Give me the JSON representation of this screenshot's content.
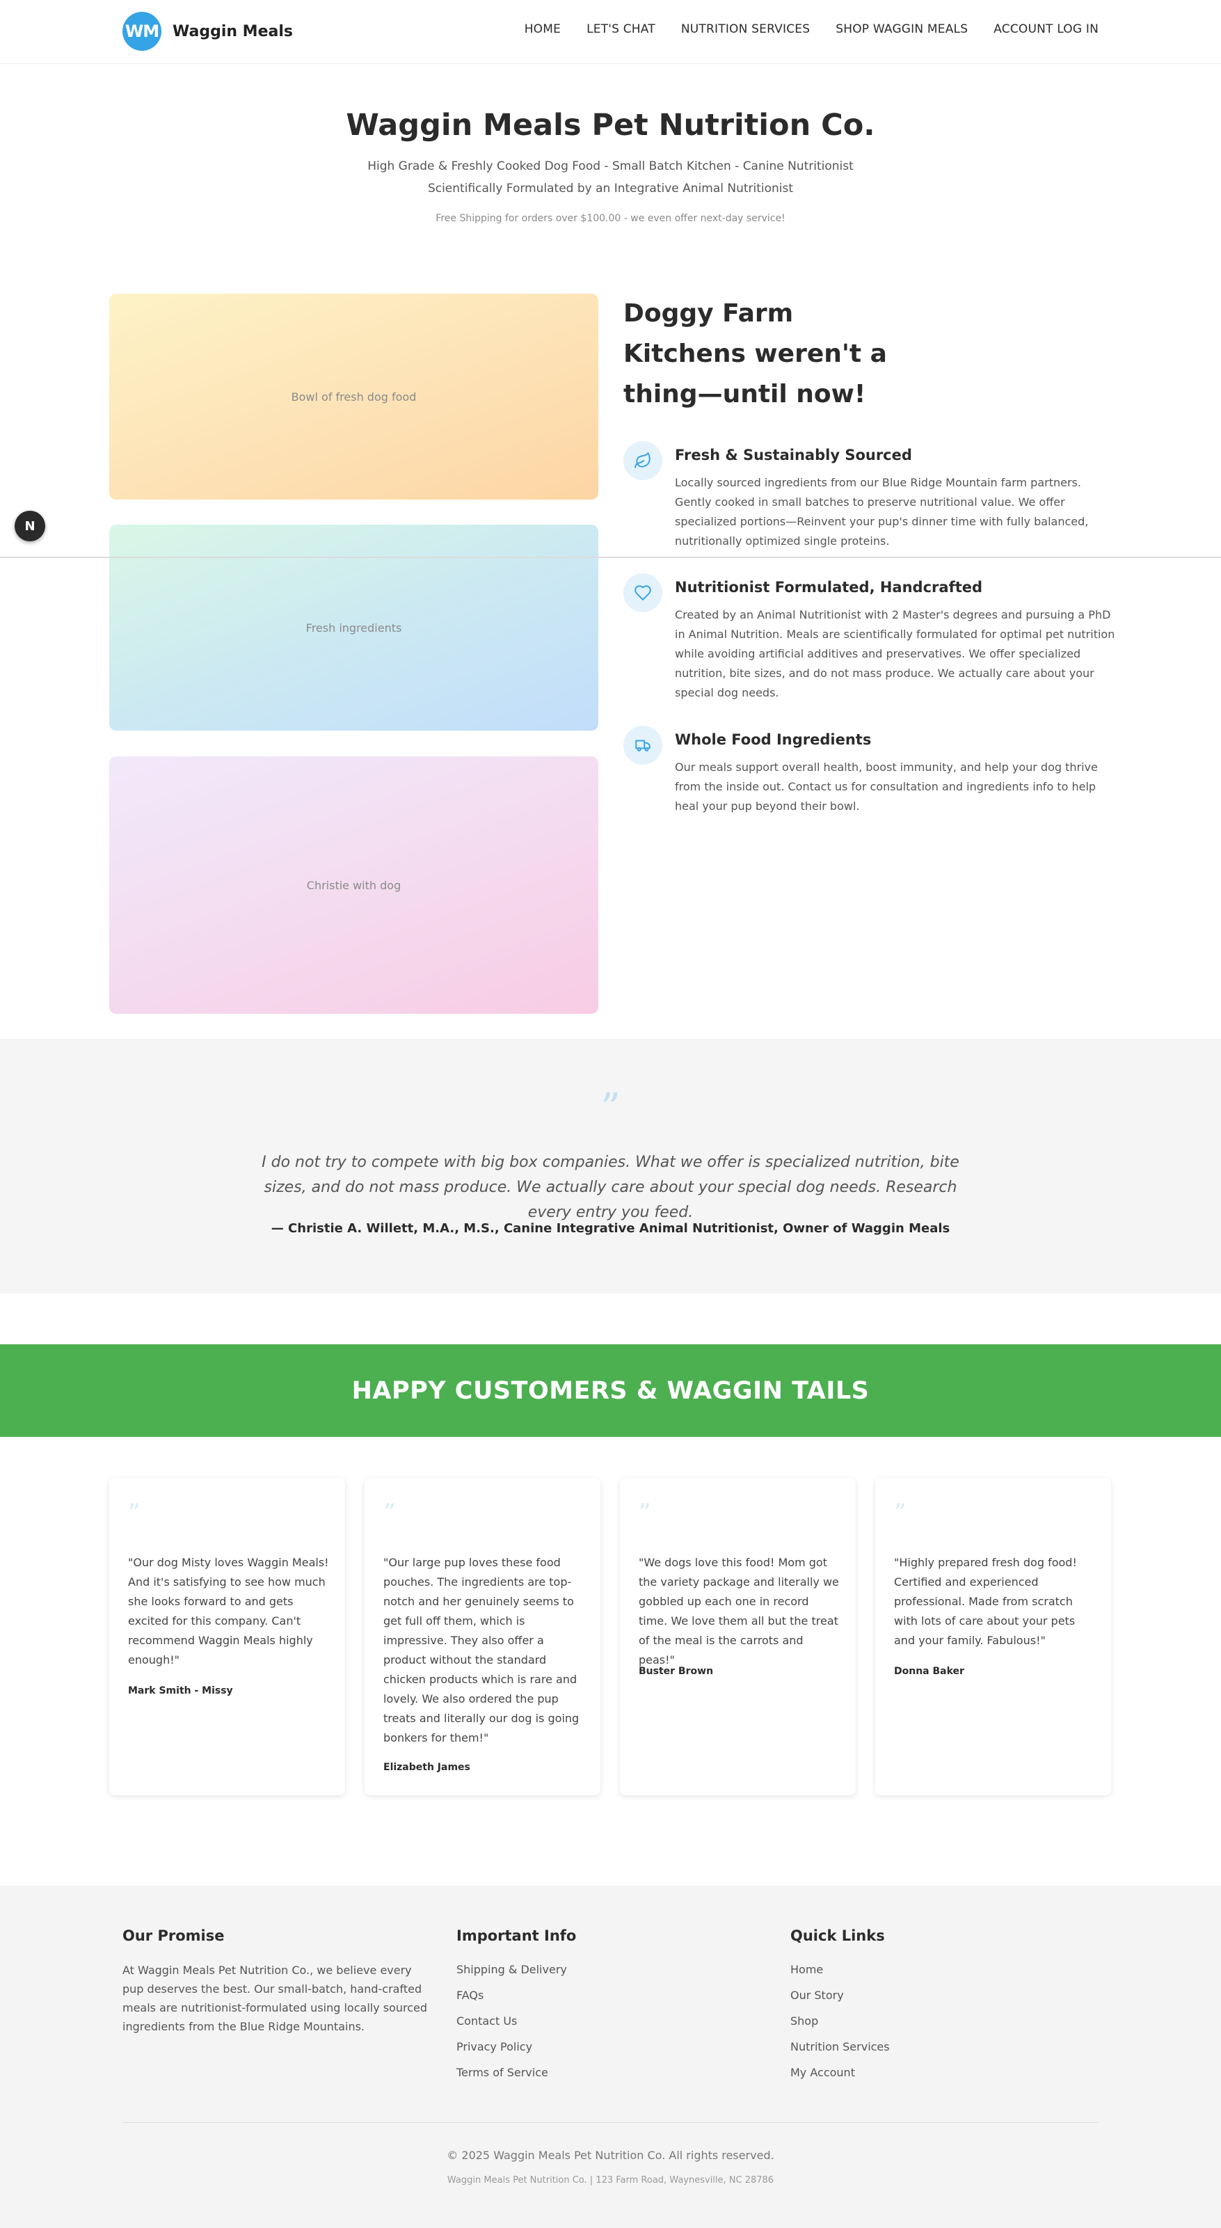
{
  "header": {
    "logo_initials": "WM",
    "brand_name": "Waggin Meals",
    "nav": [
      "HOME",
      "LET'S CHAT",
      "NUTRITION SERVICES",
      "SHOP WAGGIN MEALS",
      "ACCOUNT LOG IN"
    ]
  },
  "hero": {
    "title": "Waggin Meals Pet Nutrition Co.",
    "subtitle_line1": "High Grade & Freshly Cooked Dog Food - Small Batch Kitchen - Canine Nutritionist",
    "subtitle_line2": "Scientifically Formulated by an Integrative Animal Nutritionist",
    "shipping_note": "Free Shipping for orders over $100.00 - we even offer next-day service!"
  },
  "images": {
    "img1_alt": "Bowl of fresh dog food",
    "img2_alt": "Fresh ingredients",
    "img3_alt": "Christie with dog"
  },
  "features": {
    "title": "Doggy Farm Kitchens weren't a thing—until now!",
    "items": [
      {
        "icon": "leaf-icon",
        "title": "Fresh & Sustainably Sourced",
        "body": "Locally sourced ingredients from our Blue Ridge Mountain farm partners. Gently cooked in small batches to preserve nutritional value. We offer specialized portions—Reinvent your pup's dinner time with fully balanced, nutritionally optimized single proteins."
      },
      {
        "icon": "heart-icon",
        "title": "Nutritionist Formulated, Handcrafted",
        "body": "Created by an Animal Nutritionist with 2 Master's degrees and pursuing a PhD in Animal Nutrition. Meals are scientifically formulated for optimal pet nutrition while avoiding artificial additives and preservatives. We offer specialized nutrition, bite sizes, and do not mass produce. We actually care about your special dog needs."
      },
      {
        "icon": "truck-icon",
        "title": "Whole Food Ingredients",
        "body": "Our meals support overall health, boost immunity, and help your dog thrive from the inside out. Contact us for consultation and ingredients info to help heal your pup beyond their bowl."
      }
    ]
  },
  "quote": {
    "mark": "”",
    "text": "I do not try to compete with big box companies. What we offer is specialized nutrition, bite sizes, and do not mass produce. We actually care about your special dog needs. Research every entry you feed.",
    "author": "— Christie A. Willett, M.A., M.S., Canine Integrative Animal Nutritionist, Owner of Waggin Meals"
  },
  "testimonials": {
    "heading": "HAPPY CUSTOMERS & WAGGIN TAILS",
    "items": [
      {
        "text": "\"Our dog Misty loves Waggin Meals! And it's satisfying to see how much she looks forward to and gets excited for this company. Can't recommend Waggin Meals highly enough!\"",
        "author": "Mark Smith - Missy"
      },
      {
        "text": "\"Our large pup loves these food pouches. The ingredients are top-notch and her genuinely seems to get full off them, which is impressive. They also offer a product without the standard chicken products which is rare and lovely. We also ordered the pup treats and literally our dog is going bonkers for them!\"",
        "author": "Elizabeth James"
      },
      {
        "text": "\"We dogs love this food! Mom got the variety package and literally we gobbled up each one in record time. We love them all but the treat of the meal is the carrots and peas!\"",
        "author": "Buster Brown"
      },
      {
        "text": "\"Highly prepared fresh dog food! Certified and experienced professional. Made from scratch with lots of care about your pets and your family. Fabulous!\"",
        "author": "Donna Baker"
      }
    ]
  },
  "footer": {
    "promise_title": "Our Promise",
    "promise_text": "At Waggin Meals Pet Nutrition Co., we believe every pup deserves the best. Our small-batch, hand-crafted meals are nutritionist-formulated using locally sourced ingredients from the Blue Ridge Mountains.",
    "info_title": "Important Info",
    "info_links": [
      "Shipping & Delivery",
      "FAQs",
      "Contact Us",
      "Privacy Policy",
      "Terms of Service"
    ],
    "quick_title": "Quick Links",
    "quick_links": [
      "Home",
      "Our Story",
      "Shop",
      "Nutrition Services",
      "My Account"
    ],
    "copyright": "© 2025 Waggin Meals Pet Nutrition Co. All rights reserved.",
    "address": "Waggin Meals Pet Nutrition Co. | 123 Farm Road, Waynesville, NC 28786"
  },
  "floating_button": {
    "icon": "n-badge-icon",
    "label": "N"
  },
  "colors": {
    "accent": "#36a3e6",
    "green": "#4caf50",
    "icon_bg": "#e4f2fc"
  }
}
